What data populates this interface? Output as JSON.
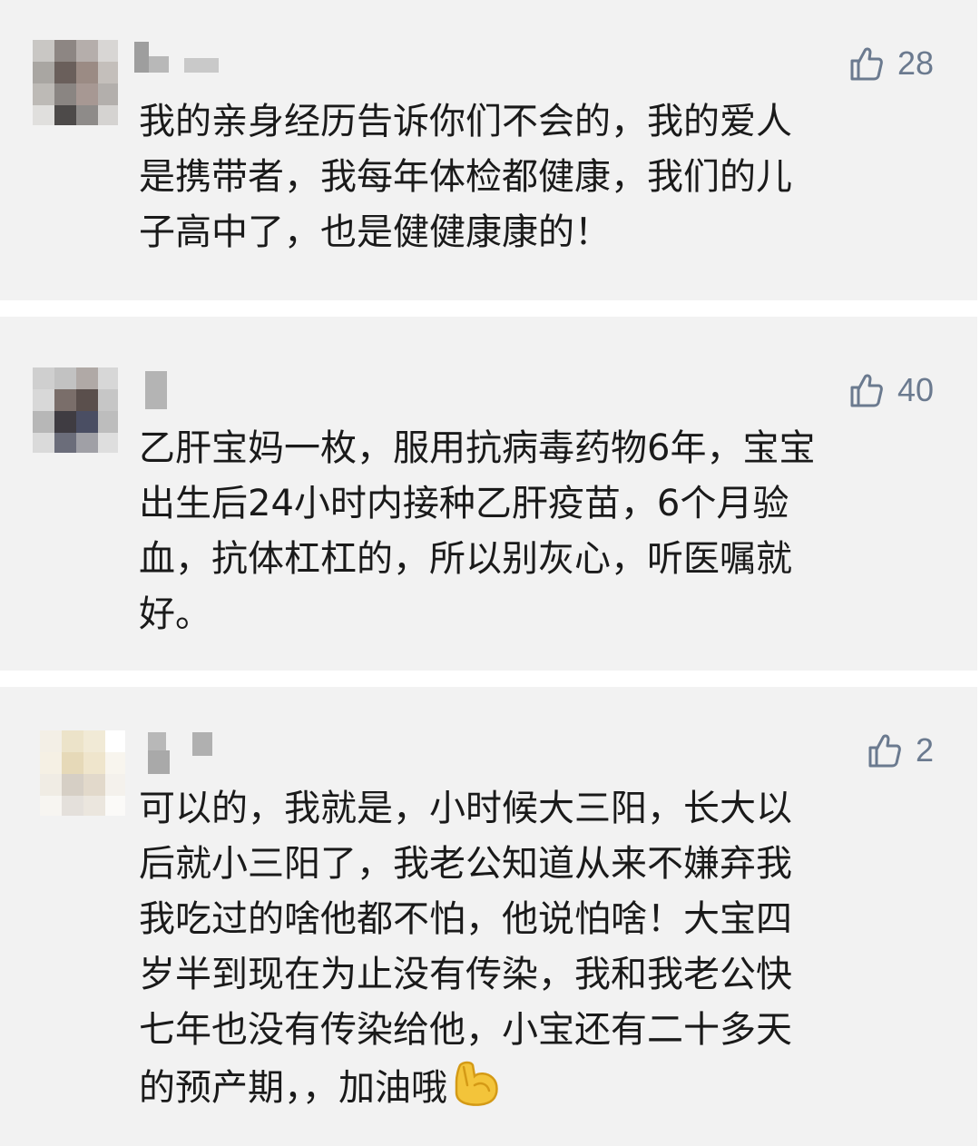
{
  "comments": [
    {
      "like_count": "28",
      "text": "我的亲身经历告诉你们不会的，我的爱人\n是携带者，我每年体检都健康，我们的儿\n子高中了，也是健健康康的！"
    },
    {
      "like_count": "40",
      "text": "乙肝宝妈一枚，服用抗病毒药物6年，宝宝\n出生后24小时内接种乙肝疫苗，6个月验\n血，抗体杠杠的，所以别灰心，听医嘱就\n好。"
    },
    {
      "like_count": "2",
      "text": "可以的，我就是，小时候大三阳，长大以\n后就小三阳了，我老公知道从来不嫌弃我\n我吃过的啥他都不怕，他说怕啥！大宝四\n岁半到现在为止没有传染，我和我老公快\n七年也没有传染给他，小宝还有二十多天\n的预产期，，加油哦",
      "trailing_emoji": "flexed-biceps-emoji"
    }
  ],
  "colors": {
    "card_background": "#f2f2f2",
    "like_color": "#6b7a8f",
    "text_color": "#1a1a1a"
  },
  "icons": {
    "like": "thumbs-up-icon"
  }
}
